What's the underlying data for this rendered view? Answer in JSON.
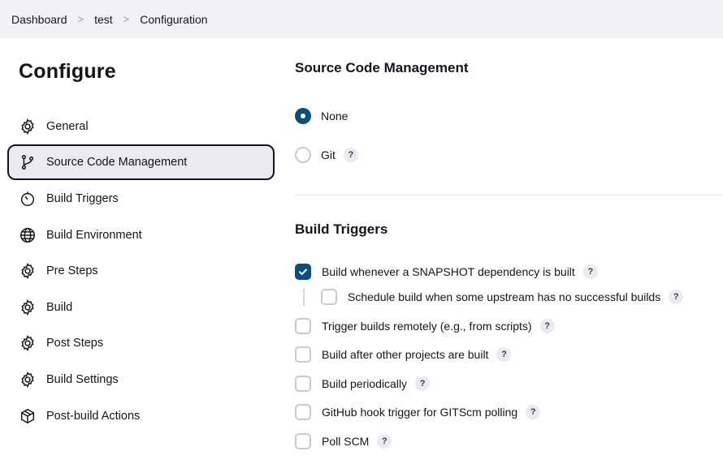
{
  "breadcrumb": [
    "Dashboard",
    "test",
    "Configuration"
  ],
  "breadcrumb_separator": ">",
  "page_title": "Configure",
  "sidebar": {
    "items": [
      {
        "label": "General",
        "icon": "gear-icon"
      },
      {
        "label": "Source Code Management",
        "icon": "branch-icon",
        "active": true
      },
      {
        "label": "Build Triggers",
        "icon": "timer-icon"
      },
      {
        "label": "Build Environment",
        "icon": "globe-icon"
      },
      {
        "label": "Pre Steps",
        "icon": "gear-icon"
      },
      {
        "label": "Build",
        "icon": "gear-icon"
      },
      {
        "label": "Post Steps",
        "icon": "gear-icon"
      },
      {
        "label": "Build Settings",
        "icon": "gear-icon"
      },
      {
        "label": "Post-build Actions",
        "icon": "package-icon"
      }
    ]
  },
  "scm": {
    "title": "Source Code Management",
    "options": [
      {
        "label": "None",
        "selected": true,
        "help": false
      },
      {
        "label": "Git",
        "selected": false,
        "help": true
      }
    ]
  },
  "triggers": {
    "title": "Build Triggers",
    "items": [
      {
        "label": "Build whenever a SNAPSHOT dependency is built",
        "checked": true,
        "help": true,
        "nested": false
      },
      {
        "label": "Schedule build when some upstream has no successful builds",
        "checked": false,
        "help": true,
        "nested": true
      },
      {
        "label": "Trigger builds remotely (e.g., from scripts)",
        "checked": false,
        "help": true,
        "nested": false
      },
      {
        "label": "Build after other projects are built",
        "checked": false,
        "help": true,
        "nested": false
      },
      {
        "label": "Build periodically",
        "checked": false,
        "help": true,
        "nested": false
      },
      {
        "label": "GitHub hook trigger for GITScm polling",
        "checked": false,
        "help": true,
        "nested": false
      },
      {
        "label": "Poll SCM",
        "checked": false,
        "help": true,
        "nested": false
      }
    ]
  },
  "help_glyph": "?",
  "colors": {
    "accent": "#0b4f7a",
    "breadcrumb_bg": "#f2f1f4",
    "active_bg": "#ebeaf0"
  }
}
